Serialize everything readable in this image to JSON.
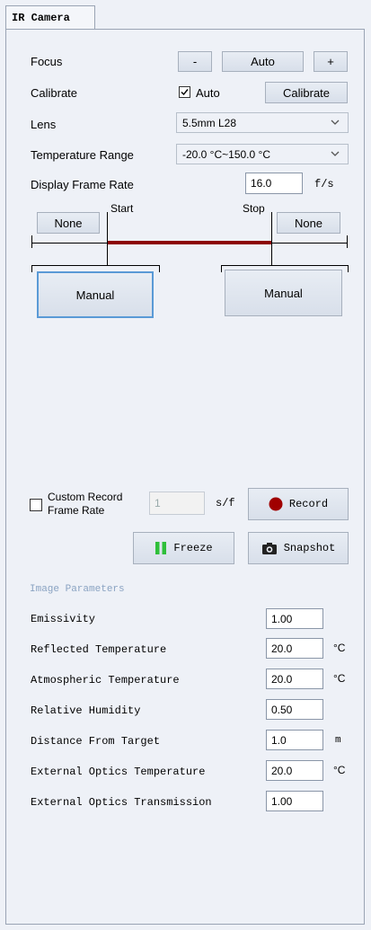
{
  "tab": {
    "title": "IR Camera"
  },
  "focus": {
    "label": "Focus",
    "minus": "-",
    "auto": "Auto",
    "plus": "+"
  },
  "calibrate": {
    "label": "Calibrate",
    "auto_label": "Auto",
    "auto_checked": true,
    "button": "Calibrate"
  },
  "lens": {
    "label": "Lens",
    "value": "5.5mm L28"
  },
  "temp_range": {
    "label": "Temperature Range",
    "value": "-20.0 °C~150.0 °C"
  },
  "frame_rate": {
    "label": "Display Frame Rate",
    "value": "16.0",
    "unit": "f/s"
  },
  "slider": {
    "start_label": "Start",
    "stop_label": "Stop",
    "left_none": "None",
    "right_none": "None",
    "left_manual": "Manual",
    "right_manual": "Manual",
    "bar_color": "#8b0000"
  },
  "record": {
    "custom_label_1": "Custom Record",
    "custom_label_2": "Frame Rate",
    "custom_checked": false,
    "value": "1",
    "unit": "s/f",
    "record_button": "Record",
    "freeze_button": "Freeze",
    "snapshot_button": "Snapshot",
    "record_color": "#a00000",
    "freeze_color": "#2fbf3a"
  },
  "params": {
    "heading": "Image Parameters",
    "rows": [
      {
        "label": "Emissivity",
        "value": "1.00",
        "unit": ""
      },
      {
        "label": "Reflected Temperature",
        "value": "20.0",
        "unit": "°C"
      },
      {
        "label": "Atmospheric Temperature",
        "value": "20.0",
        "unit": "°C"
      },
      {
        "label": "Relative Humidity",
        "value": "0.50",
        "unit": ""
      },
      {
        "label": "Distance From Target",
        "value": "1.0",
        "unit": "m"
      },
      {
        "label": "External Optics Temperature",
        "value": "20.0",
        "unit": "°C"
      },
      {
        "label": "External Optics Transmission",
        "value": "1.00",
        "unit": ""
      }
    ]
  }
}
